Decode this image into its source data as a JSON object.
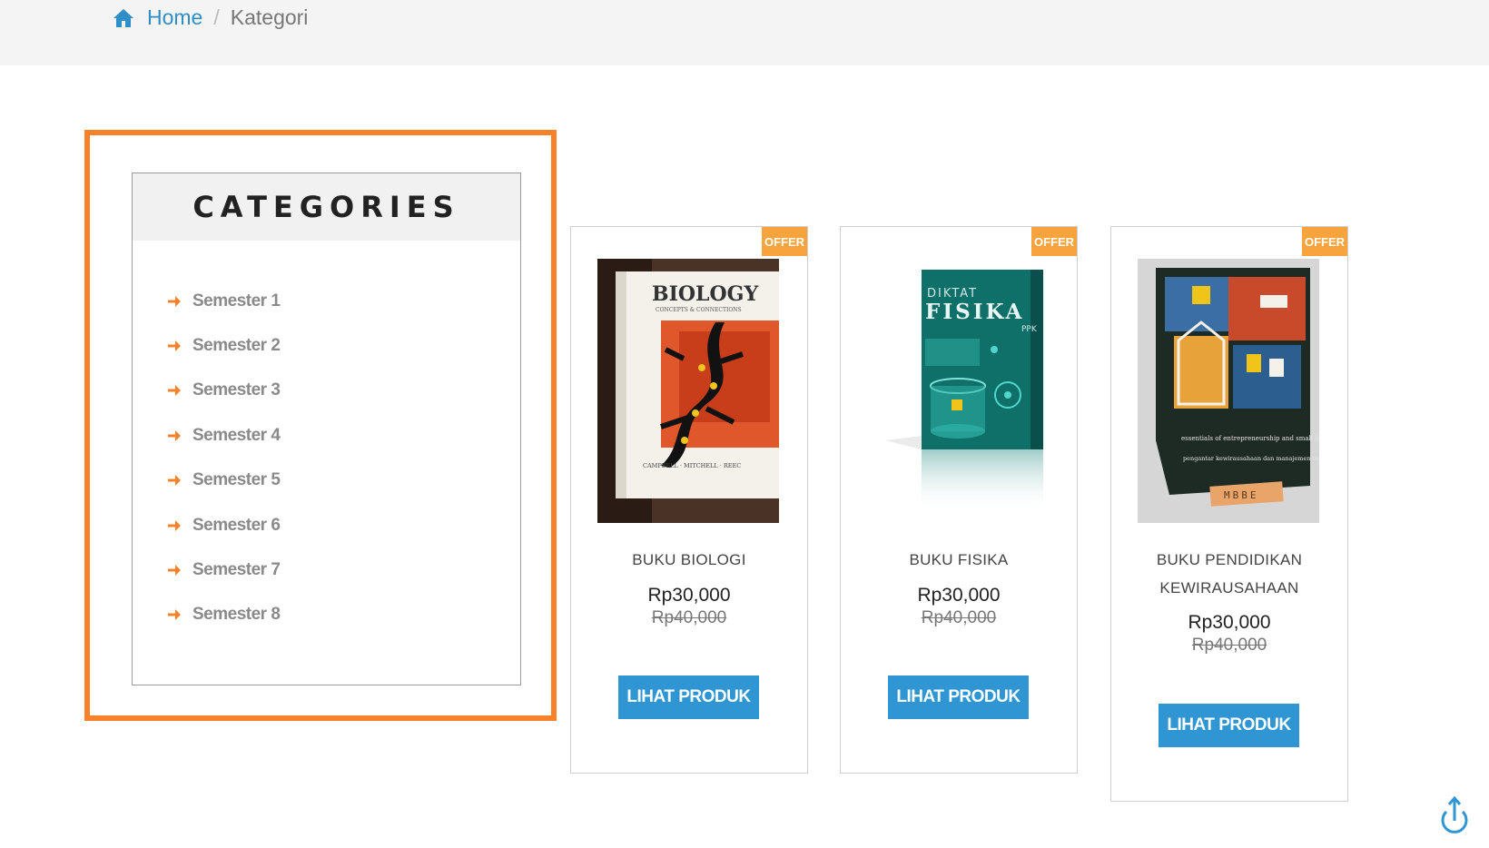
{
  "breadcrumb": {
    "home_icon": "home-icon",
    "home_label": "Home",
    "separator": "/",
    "current": "Kategori"
  },
  "sidebar": {
    "title": "CATEGORIES",
    "item_icon": "arrow-right-icon",
    "items": [
      {
        "label": "Semester 1"
      },
      {
        "label": "Semester 2"
      },
      {
        "label": "Semester 3"
      },
      {
        "label": "Semester 4"
      },
      {
        "label": "Semester 5"
      },
      {
        "label": "Semester 6"
      },
      {
        "label": "Semester 7"
      },
      {
        "label": "Semester 8"
      }
    ]
  },
  "products": [
    {
      "badge": "OFFER",
      "name_line1": "BUKU BIOLOGI",
      "name_line2": "",
      "price": "Rp30,000",
      "old_price": "Rp40,000",
      "button": "LIHAT PRODUK",
      "cover_title": "BIOLOGY",
      "cover_subtitle": "CONCEPTS & CONNECTIONS",
      "cover_authors": "CAMPBELL · MITCHELL · REEC"
    },
    {
      "badge": "OFFER",
      "name_line1": "BUKU FISIKA",
      "name_line2": "",
      "price": "Rp30,000",
      "old_price": "Rp40,000",
      "button": "LIHAT PRODUK",
      "cover_title": "FISIKA",
      "cover_subtitle": "DIKTAT",
      "cover_authors": "PPK"
    },
    {
      "badge": "OFFER",
      "name_line1": "BUKU PENDIDIKAN",
      "name_line2": "KEWIRAUSAHAAN",
      "price": "Rp30,000",
      "old_price": "Rp40,000",
      "button": "LIHAT PRODUK",
      "cover_title": "essentials of entrepreneurship and small business management",
      "cover_subtitle": "pengantar kewirausahaan dan manajemen bisnis kecil",
      "cover_authors": "MBBE"
    }
  ],
  "colors": {
    "accent": "#f7822a",
    "link": "#2f8ec6",
    "button": "#2f95d3",
    "offer": "#f7a43f"
  },
  "scroll_icon": "power-scroll-top-icon"
}
